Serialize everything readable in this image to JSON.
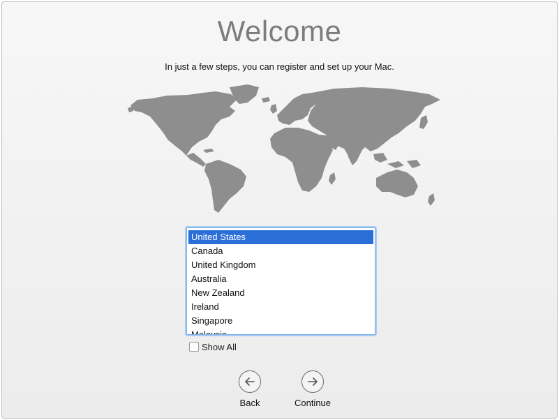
{
  "welcome": {
    "title": "Welcome",
    "subtitle": "In just a few steps, you can register and set up your Mac."
  },
  "country_list": {
    "selected_index": 0,
    "items": [
      "United States",
      "Canada",
      "United Kingdom",
      "Australia",
      "New Zealand",
      "Ireland",
      "Singapore",
      "Malaysia"
    ]
  },
  "show_all": {
    "label": "Show All",
    "checked": false
  },
  "nav": {
    "back_label": "Back",
    "continue_label": "Continue",
    "back_icon": "arrow-left-circle-icon",
    "continue_icon": "arrow-right-circle-icon"
  },
  "colors": {
    "selection": "#2a6ed8",
    "map_land": "#8e8e8e"
  }
}
